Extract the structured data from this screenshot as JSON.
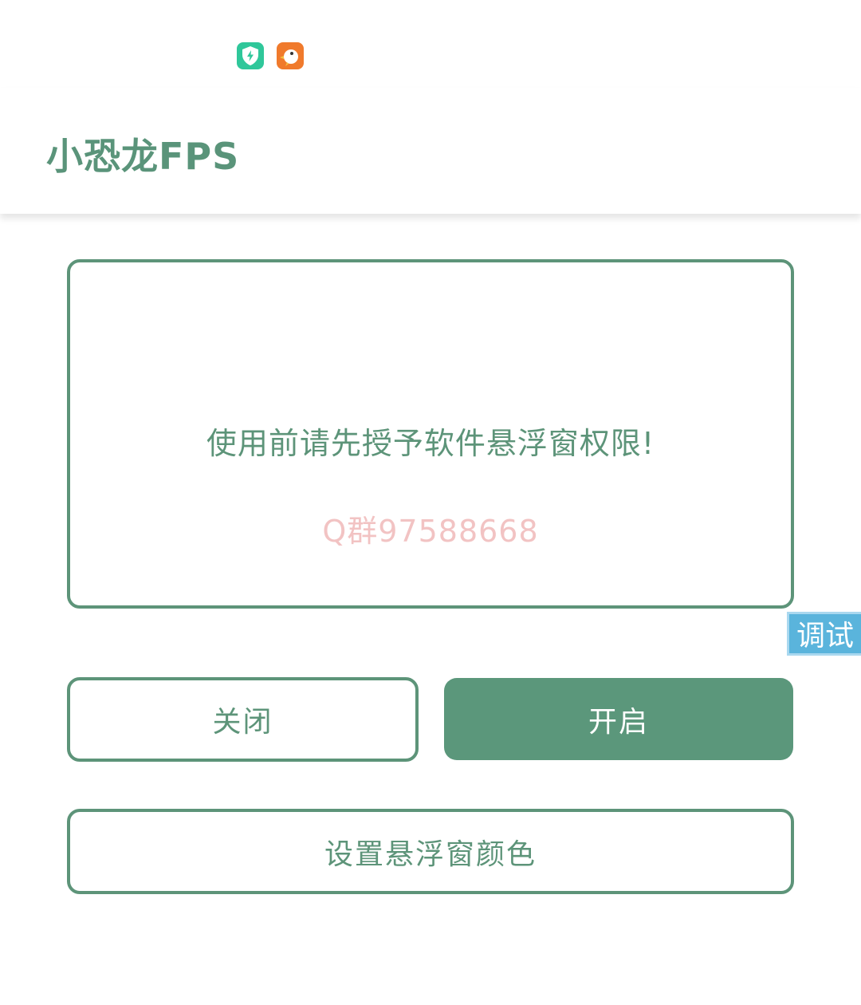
{
  "status_bar": {
    "icons": [
      "shield-bolt-icon",
      "duck-icon"
    ]
  },
  "app_bar": {
    "title": "小恐龙FPS"
  },
  "info_card": {
    "message": "使用前请先授予软件悬浮窗权限!",
    "contact": "Q群97588668"
  },
  "debug_tag": {
    "label": "调试"
  },
  "buttons": {
    "close_label": "关闭",
    "open_label": "开启",
    "set_color_label": "设置悬浮窗颜色"
  },
  "colors": {
    "accent": "#5d9479",
    "contact_text": "#f2c3c3",
    "debug_bg": "#5ab4dc"
  }
}
